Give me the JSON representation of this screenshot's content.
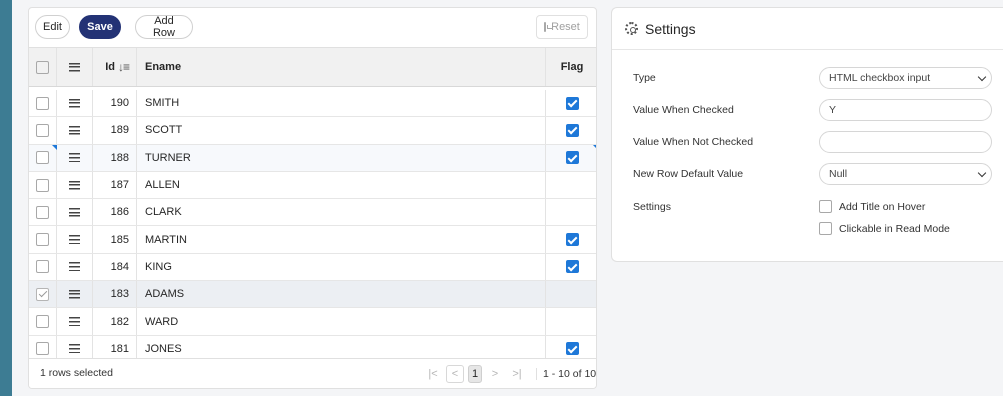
{
  "toolbar": {
    "edit_label": "Edit",
    "save_label": "Save",
    "add_row_label": "Add Row",
    "reset_label": "Reset"
  },
  "grid": {
    "columns": {
      "id": "Id",
      "ename": "Ename",
      "flag": "Flag"
    },
    "rows": [
      {
        "id": "190",
        "ename": "SMITH",
        "flag": true,
        "selected": false
      },
      {
        "id": "189",
        "ename": "SCOTT",
        "flag": true,
        "selected": false
      },
      {
        "id": "188",
        "ename": "TURNER",
        "flag": true,
        "selected": false
      },
      {
        "id": "187",
        "ename": "ALLEN",
        "flag": false,
        "selected": false
      },
      {
        "id": "186",
        "ename": "CLARK",
        "flag": false,
        "selected": false
      },
      {
        "id": "185",
        "ename": "MARTIN",
        "flag": true,
        "selected": false
      },
      {
        "id": "184",
        "ename": "KING",
        "flag": true,
        "selected": false
      },
      {
        "id": "183",
        "ename": "ADAMS",
        "flag": false,
        "selected": true
      },
      {
        "id": "182",
        "ename": "WARD",
        "flag": false,
        "selected": false
      },
      {
        "id": "181",
        "ename": "JONES",
        "flag": true,
        "selected": false
      }
    ],
    "footer": {
      "rows_selected": "1 rows selected",
      "current_page": "1",
      "range": "1 - 10 of 10"
    }
  },
  "settings": {
    "title": "Settings",
    "type_label": "Type",
    "type_value": "HTML checkbox input",
    "checked_label": "Value When Checked",
    "checked_value": "Y",
    "unchecked_label": "Value When Not Checked",
    "unchecked_value": "",
    "default_label": "New Row Default Value",
    "default_value": "Null",
    "settings_label": "Settings",
    "opt_title_hover": "Add Title on Hover",
    "opt_clickable": "Clickable in Read Mode"
  }
}
